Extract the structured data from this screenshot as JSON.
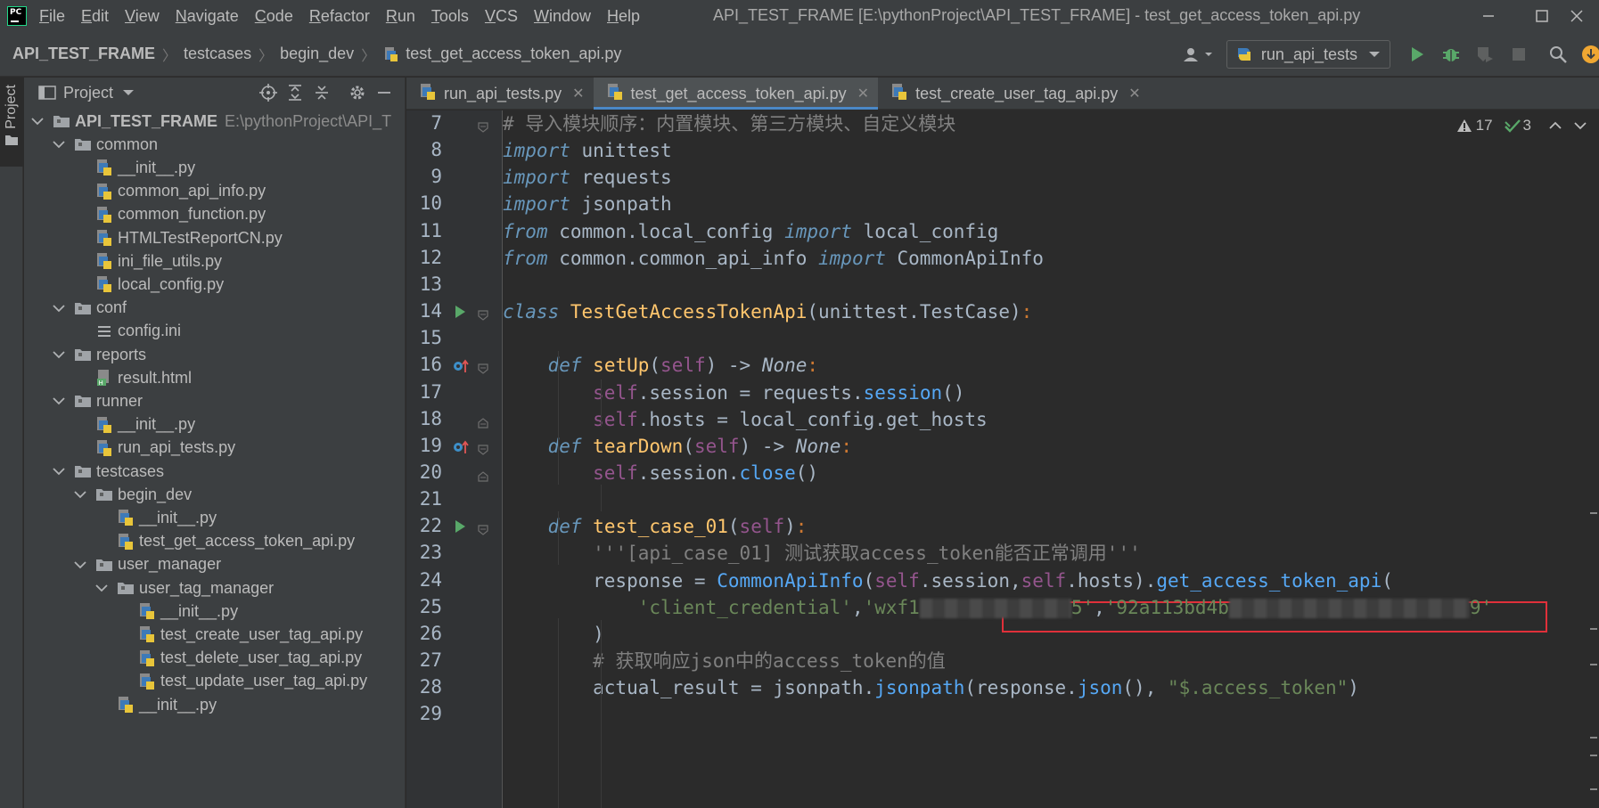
{
  "menu": {
    "items": [
      {
        "label": "File",
        "u": "F",
        "rest": "ile"
      },
      {
        "label": "Edit",
        "u": "E",
        "rest": "dit"
      },
      {
        "label": "View",
        "u": "V",
        "rest": "iew"
      },
      {
        "label": "Navigate",
        "u": "N",
        "rest": "avigate"
      },
      {
        "label": "Code",
        "u": "C",
        "rest": "ode"
      },
      {
        "label": "Refactor",
        "u": "R",
        "rest": "efactor"
      },
      {
        "label": "Run",
        "u": "R",
        "rest": "un"
      },
      {
        "label": "Tools",
        "u": "T",
        "rest": "ools"
      },
      {
        "label": "VCS",
        "u": "V",
        "rest": "CS"
      },
      {
        "label": "Window",
        "u": "W",
        "rest": "indow"
      },
      {
        "label": "Help",
        "u": "H",
        "rest": "elp"
      }
    ],
    "window_title": "API_TEST_FRAME [E:\\pythonProject\\API_TEST_FRAME] - test_get_access_token_api.py"
  },
  "breadcrumb": {
    "items": [
      "API_TEST_FRAME",
      "testcases",
      "begin_dev",
      "test_get_access_token_api.py"
    ]
  },
  "toolbar": {
    "run_config": "run_api_tests"
  },
  "stripe": {
    "project_label": "Project"
  },
  "project_panel": {
    "title": "Project",
    "tree": [
      {
        "label": "API_TEST_FRAME",
        "hint": "E:\\pythonProject\\API_T",
        "type": "root",
        "depth": 0,
        "open": true
      },
      {
        "label": "common",
        "type": "dir",
        "depth": 1,
        "open": true
      },
      {
        "label": "__init__.py",
        "type": "py",
        "depth": 2
      },
      {
        "label": "common_api_info.py",
        "type": "py",
        "depth": 2
      },
      {
        "label": "common_function.py",
        "type": "py",
        "depth": 2
      },
      {
        "label": "HTMLTestReportCN.py",
        "type": "py",
        "depth": 2
      },
      {
        "label": "ini_file_utils.py",
        "type": "py",
        "depth": 2
      },
      {
        "label": "local_config.py",
        "type": "py",
        "depth": 2
      },
      {
        "label": "conf",
        "type": "dir",
        "depth": 1,
        "open": true
      },
      {
        "label": "config.ini",
        "type": "ini",
        "depth": 2
      },
      {
        "label": "reports",
        "type": "dir",
        "depth": 1,
        "open": true
      },
      {
        "label": "result.html",
        "type": "html",
        "depth": 2
      },
      {
        "label": "runner",
        "type": "dir",
        "depth": 1,
        "open": true
      },
      {
        "label": "__init__.py",
        "type": "py",
        "depth": 2
      },
      {
        "label": "run_api_tests.py",
        "type": "py",
        "depth": 2
      },
      {
        "label": "testcases",
        "type": "dir",
        "depth": 1,
        "open": true
      },
      {
        "label": "begin_dev",
        "type": "dir",
        "depth": 2,
        "open": true
      },
      {
        "label": "__init__.py",
        "type": "py",
        "depth": 3
      },
      {
        "label": "test_get_access_token_api.py",
        "type": "py",
        "depth": 3
      },
      {
        "label": "user_manager",
        "type": "dir",
        "depth": 2,
        "open": true
      },
      {
        "label": "user_tag_manager",
        "type": "dir",
        "depth": 3,
        "open": true
      },
      {
        "label": "__init__.py",
        "type": "py",
        "depth": 4
      },
      {
        "label": "test_create_user_tag_api.py",
        "type": "py",
        "depth": 4
      },
      {
        "label": "test_delete_user_tag_api.py",
        "type": "py",
        "depth": 4
      },
      {
        "label": "test_update_user_tag_api.py",
        "type": "py",
        "depth": 4
      },
      {
        "label": "__init__.py",
        "type": "py",
        "depth": 3
      }
    ]
  },
  "editor": {
    "tabs": [
      {
        "label": "run_api_tests.py",
        "active": false
      },
      {
        "label": "test_get_access_token_api.py",
        "active": true
      },
      {
        "label": "test_create_user_tag_api.py",
        "active": false
      }
    ],
    "inspection": {
      "warnings": "17",
      "checks": "3"
    },
    "lines": [
      {
        "n": "7",
        "html": "<span class='cmt'># 导入模块顺序：内置模块、第三方模块、自定义模块</span>",
        "fold": "open"
      },
      {
        "n": "8",
        "html": "<span class='import-kw'>import</span> unittest"
      },
      {
        "n": "9",
        "html": "<span class='import-kw'>import</span> requests"
      },
      {
        "n": "10",
        "html": "<span class='import-kw'>import</span> jsonpath"
      },
      {
        "n": "11",
        "html": "<span class='import-kw'>from</span> common.local_config <span class='import-kw'>import</span> local_config"
      },
      {
        "n": "12",
        "html": "<span class='import-kw'>from</span> common.common_api_info <span class='import-kw'>import</span> CommonApiInfo"
      },
      {
        "n": "13",
        "html": ""
      },
      {
        "n": "14",
        "html": "<span class='import-kw'>class</span> <span class='fn'>TestGetAccessTokenApi</span>(unittest.TestCase)<span class='kw'>:</span>",
        "mark": "run",
        "fold": "open"
      },
      {
        "n": "15",
        "html": ""
      },
      {
        "n": "16",
        "html": "    <span class='import-kw'>def</span> <span class='fn'>setUp</span>(<span class='slf'>self</span>) -> <span style='font-style:italic;color:#a9b7c6'>None</span><span class='kw'>:</span>",
        "mark": "override",
        "fold": "open"
      },
      {
        "n": "17",
        "html": "        <span class='slf'>self</span>.session = requests.<span class='call'>session</span>()"
      },
      {
        "n": "18",
        "html": "        <span class='slf'>self</span>.hosts = local_config.get_hosts",
        "fold": "close"
      },
      {
        "n": "19",
        "html": "    <span class='import-kw'>def</span> <span class='fn'>tearDown</span>(<span class='slf'>self</span>) -> <span style='font-style:italic;color:#a9b7c6'>None</span><span class='kw'>:</span>",
        "mark": "override",
        "fold": "open"
      },
      {
        "n": "20",
        "html": "        <span class='slf'>self</span>.session.<span class='call'>close</span>()",
        "fold": "close"
      },
      {
        "n": "21",
        "html": ""
      },
      {
        "n": "22",
        "html": "    <span class='import-kw'>def</span> <span class='fn'>test_case_01</span>(<span class='slf'>self</span>)<span class='kw'>:</span>",
        "mark": "run",
        "fold": "open"
      },
      {
        "n": "23",
        "html": "        <span class='cmt'>'''[api_case_01] 测试获取access_token能否正常调用'''</span>"
      },
      {
        "n": "24",
        "html": "        response = <span class='call'>CommonApiInfo</span>(<span class='slf'>self</span>.session,<span class='slf'>self</span>.hosts).<span class='call'>get_access_token_api</span>("
      },
      {
        "n": "25",
        "html": "            <span class='str'>'client_credential'</span>,<span class='str'>'wxf1<span class=\"blur\" style=\"width:170px\"></span>5'</span>,<span class='str'>'92a113bd4b<span class=\"blur\" style=\"width:270px\"></span>9'</span>"
      },
      {
        "n": "26",
        "html": "        )"
      },
      {
        "n": "27",
        "html": "        <span class='cmt'># 获取响应json中的access_token的值</span>"
      },
      {
        "n": "28",
        "html": "        actual_result = jsonpath.<span class='call'>jsonpath</span>(response.<span class='call'>json</span>(), <span class='str'>\"$.access_token\"</span>)"
      },
      {
        "n": "29",
        "html": ""
      }
    ]
  }
}
